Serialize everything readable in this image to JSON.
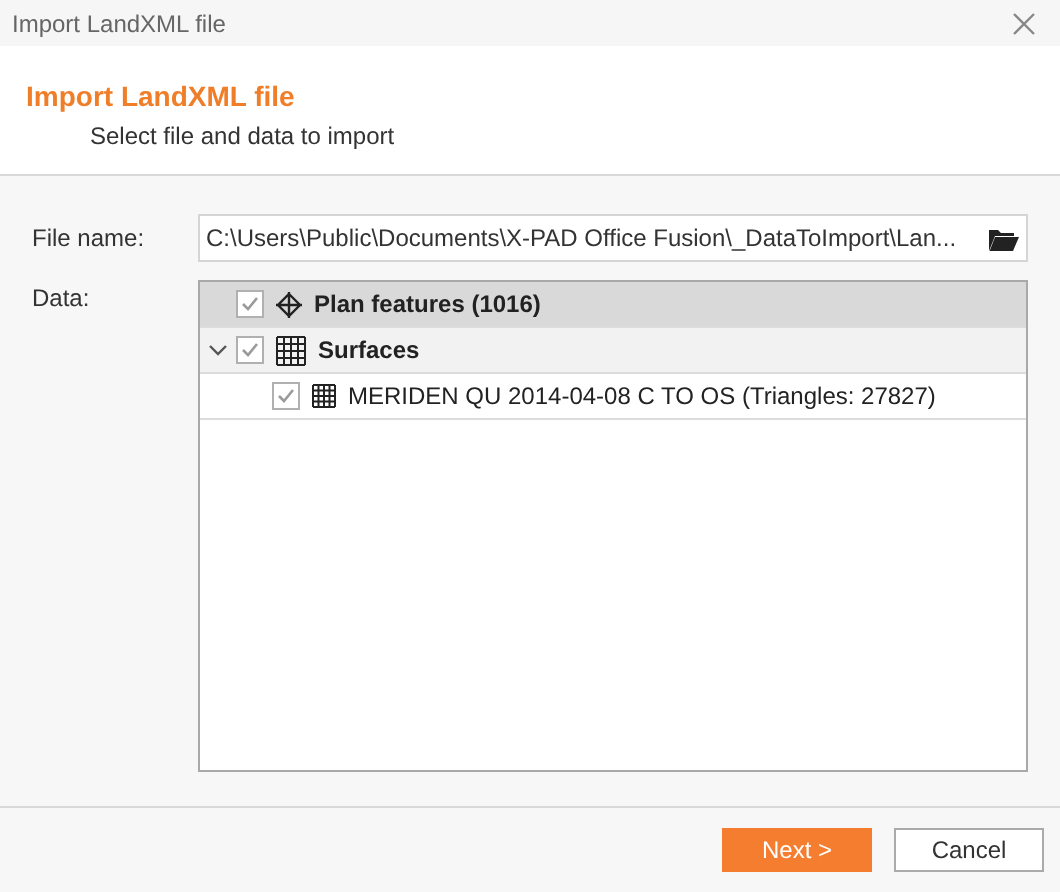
{
  "window": {
    "title": "Import LandXML file"
  },
  "header": {
    "title": "Import LandXML file",
    "subtitle": "Select file and data to import"
  },
  "file_name": {
    "label": "File name:",
    "value": "C:\\Users\\Public\\Documents\\X-PAD Office Fusion\\_DataToImport\\Lan..."
  },
  "data": {
    "label": "Data:",
    "items": [
      {
        "label": "Plan features (1016)",
        "kind": "points",
        "checked": true,
        "selected": true
      },
      {
        "label": "Surfaces",
        "kind": "surfaces",
        "checked": true,
        "selected": false,
        "expanded": true,
        "children": [
          {
            "label": "MERIDEN QU 2014-04-08 C TO OS (Triangles: 27827)",
            "kind": "surface",
            "checked": true,
            "selected": false
          }
        ]
      }
    ]
  },
  "buttons": [
    {
      "label": "Next >",
      "kind": "primary"
    },
    {
      "label": "Cancel",
      "kind": "secondary"
    }
  ]
}
